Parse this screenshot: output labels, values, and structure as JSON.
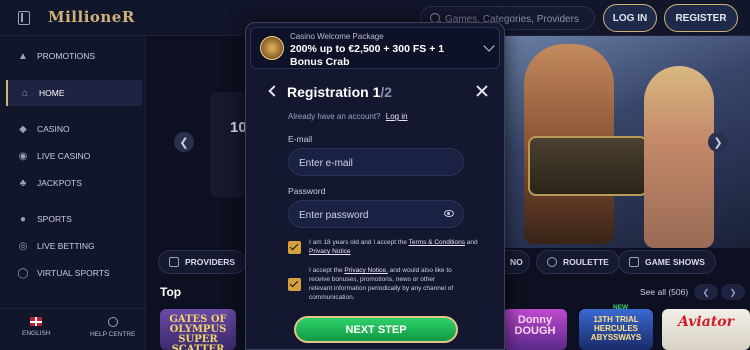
{
  "header": {
    "logo": "MillioneR",
    "search_placeholder": "Games, Categories, Providers",
    "login_label": "LOG IN",
    "register_label": "REGISTER"
  },
  "sidebar": {
    "items": [
      {
        "label": "PROMOTIONS",
        "icon": "megaphone-icon"
      },
      {
        "label": "HOME",
        "icon": "home-icon",
        "active": true
      },
      {
        "label": "CASINO",
        "icon": "diamond-icon"
      },
      {
        "label": "LIVE CASINO",
        "icon": "chip-icon"
      },
      {
        "label": "JACKPOTS",
        "icon": "clover-icon"
      },
      {
        "label": "SPORTS",
        "icon": "ball-icon"
      },
      {
        "label": "LIVE BETTING",
        "icon": "live-icon"
      },
      {
        "label": "VIRTUAL SPORTS",
        "icon": "globe-icon"
      }
    ],
    "footer": {
      "language_label": "ENGLISH",
      "help_label": "HELP CENTRE"
    }
  },
  "main": {
    "banner_fragment": "10",
    "categories": [
      "PROVIDERS",
      "NO",
      "ROULETTE",
      "GAME SHOWS"
    ],
    "section_title": "Top",
    "see_all": "See all (506)",
    "tiles": {
      "olympus": "GATES OF OLYMPUS SUPER SCATTER",
      "dough": "Donny DOUGH",
      "hercules": "13TH TRIAL HERCULES ABYSSWAYS",
      "new_badge": "NEW",
      "aviator": "Aviator"
    }
  },
  "modal": {
    "promo_title": "Casino Welcome Package",
    "promo_offer": "200% up to €2,500 + 300 FS + 1 Bonus Crab",
    "title": "Registration 1",
    "title_total": "/2",
    "have_account": "Already have an account?",
    "login_link": "Log in",
    "email_label": "E-mail",
    "email_placeholder": "Enter e-mail",
    "password_label": "Password",
    "password_placeholder": "Enter password",
    "consent1_prefix": "I am 18 years old and I accept the",
    "consent1_terms": "Terms & Conditions",
    "consent1_and": "and",
    "consent1_privacy": "Privacy Notice",
    "consent2_prefix": "I accept the",
    "consent2_privacy": "Privacy Notice,",
    "consent2_suffix": "and would also like to receive bonuses, promotions, news or other relevant information periodically by any channel of communication.",
    "next_label": "NEXT STEP"
  },
  "colors": {
    "accent_gold": "#cfb27a",
    "cta_green": "#2fd06a",
    "background": "#0d1020"
  }
}
